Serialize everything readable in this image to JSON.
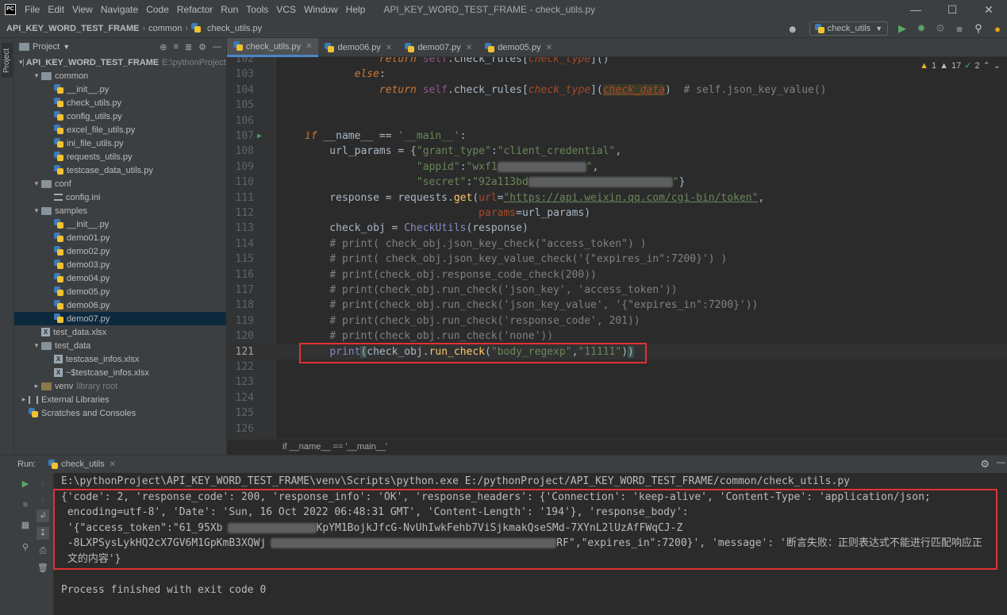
{
  "menubar": {
    "logo_text": "PC",
    "items": [
      "File",
      "Edit",
      "View",
      "Navigate",
      "Code",
      "Refactor",
      "Run",
      "Tools",
      "VCS",
      "Window",
      "Help"
    ],
    "window_title": "API_KEY_WORD_TEST_FRAME - check_utils.py"
  },
  "navbar": {
    "project": "API_KEY_WORD_TEST_FRAME",
    "folder": "common",
    "file": "check_utils.py",
    "run_config": "check_utils"
  },
  "project_panel": {
    "title": "Project",
    "tree": [
      {
        "label": "API_KEY_WORD_TEST_FRAME",
        "extra": "E:\\pythonProject",
        "type": "folder",
        "depth": 0,
        "expanded": true,
        "bold": true
      },
      {
        "label": "common",
        "type": "folder",
        "depth": 1,
        "expanded": true
      },
      {
        "label": "__init__.py",
        "type": "py",
        "depth": 2
      },
      {
        "label": "check_utils.py",
        "type": "py",
        "depth": 2
      },
      {
        "label": "config_utils.py",
        "type": "py",
        "depth": 2
      },
      {
        "label": "excel_file_utils.py",
        "type": "py",
        "depth": 2
      },
      {
        "label": "ini_file_utils.py",
        "type": "py",
        "depth": 2
      },
      {
        "label": "requests_utils.py",
        "type": "py",
        "depth": 2
      },
      {
        "label": "testcase_data_utils.py",
        "type": "py",
        "depth": 2
      },
      {
        "label": "conf",
        "type": "folder",
        "depth": 1,
        "expanded": true
      },
      {
        "label": "config.ini",
        "type": "ini",
        "depth": 2
      },
      {
        "label": "samples",
        "type": "folder",
        "depth": 1,
        "expanded": true
      },
      {
        "label": "__init__.py",
        "type": "py",
        "depth": 2
      },
      {
        "label": "demo01.py",
        "type": "py",
        "depth": 2
      },
      {
        "label": "demo02.py",
        "type": "py",
        "depth": 2
      },
      {
        "label": "demo03.py",
        "type": "py",
        "depth": 2
      },
      {
        "label": "demo04.py",
        "type": "py",
        "depth": 2
      },
      {
        "label": "demo05.py",
        "type": "py",
        "depth": 2
      },
      {
        "label": "demo06.py",
        "type": "py",
        "depth": 2
      },
      {
        "label": "demo07.py",
        "type": "py",
        "depth": 2,
        "selected": true
      },
      {
        "label": "test_data.xlsx",
        "type": "xl",
        "depth": 1
      },
      {
        "label": "test_data",
        "type": "folder",
        "depth": 1,
        "expanded": true
      },
      {
        "label": "testcase_infos.xlsx",
        "type": "xl",
        "depth": 2
      },
      {
        "label": "~$testcase_infos.xlsx",
        "type": "xl",
        "depth": 2
      },
      {
        "label": "venv",
        "extra": "library root",
        "type": "folder",
        "depth": 1,
        "expanded": false,
        "venv": true
      },
      {
        "label": "External Libraries",
        "type": "lib",
        "depth": 0,
        "expanded": false
      },
      {
        "label": "Scratches and Consoles",
        "type": "scratch",
        "depth": 0
      }
    ]
  },
  "editor_tabs": [
    {
      "label": "check_utils.py",
      "active": true
    },
    {
      "label": "demo06.py",
      "active": false
    },
    {
      "label": "demo07.py",
      "active": false
    },
    {
      "label": "demo05.py",
      "active": false
    }
  ],
  "inspections": {
    "warnings": "1",
    "weak_warnings": "17",
    "typos": "2"
  },
  "code_lines": [
    {
      "n": "102",
      "html": "            <span class=\"kw\">return</span> <span class=\"slf\">self</span>.check_rules[<span class=\"par\" style=\"font-style:italic\">check_type</span>]()"
    },
    {
      "n": "103",
      "html": "        <span class=\"kw\">else</span>:"
    },
    {
      "n": "104",
      "html": "            <span class=\"kw\">return</span> <span class=\"slf\">self</span>.check_rules[<span class=\"par\" style=\"font-style:italic\">check_type</span>](<span class=\"par\" style=\"font-style:italic;text-decoration:underline;background:#3b3b2b\">check_data</span>)  <span class=\"cmt\"># self.json_key_value()</span>"
    },
    {
      "n": "105",
      "html": ""
    },
    {
      "n": "106",
      "html": ""
    },
    {
      "n": "107",
      "html": "<span class=\"kw\">if</span> __name__ == <span class=\"str\">'__main__'</span>:",
      "run": true
    },
    {
      "n": "108",
      "html": "    url_params = {<span class=\"str\">\"grant_type\"</span>:<span class=\"str\">\"client_credential\"</span>,"
    },
    {
      "n": "109",
      "html": "                  <span class=\"str\">\"appid\"</span>:<span class=\"str\">\"wxf1</span><span class=\"blurred\" style=\"width:112px\"></span><span class=\"str\">\"</span>,"
    },
    {
      "n": "110",
      "html": "                  <span class=\"str\">\"secret\"</span>:<span class=\"str\">\"92a113bd</span><span class=\"blurred\" style=\"width:182px\"></span><span class=\"str\">\"</span>}"
    },
    {
      "n": "111",
      "html": "    response = requests.<span class=\"fn\">get</span>(<span class=\"par\">url</span>=<span class=\"url\">\"https://api.weixin.qq.com/cgi-bin/token\"</span>,"
    },
    {
      "n": "112",
      "html": "                            <span class=\"par\">params</span>=url_params)"
    },
    {
      "n": "113",
      "html": "    check_obj = <span class=\"blue\">CheckUtils</span>(response)"
    },
    {
      "n": "114",
      "html": "    <span class=\"cmt\"># print( check_obj.json_key_check(\"access_token\") )</span>"
    },
    {
      "n": "115",
      "html": "    <span class=\"cmt\"># print( check_obj.json_key_value_check('{\"expires_in\":7200}') )</span>"
    },
    {
      "n": "116",
      "html": "    <span class=\"cmt\"># print(check_obj.response_code_check(200))</span>"
    },
    {
      "n": "117",
      "html": "    <span class=\"cmt\"># print(check_obj.run_check('json_key', 'access_token'))</span>"
    },
    {
      "n": "118",
      "html": "    <span class=\"cmt\"># print(check_obj.run_check('json_key_value', '{\"expires_in\":7200}'))</span>"
    },
    {
      "n": "119",
      "html": "    <span class=\"cmt\"># print(check_obj.run_check('response_code', 201))</span>"
    },
    {
      "n": "120",
      "html": "    <span class=\"cmt\"># print(check_obj.run_check('none'))</span>"
    },
    {
      "n": "121",
      "html": "    <span class=\"blue\">print</span><span style=\"background:#3b514d\">(</span>check_obj.<span class=\"fn\">run_check</span>(<span class=\"str\">\"body_regexp\"</span>,<span class=\"str\">\"11111\"</span>)<span style=\"background:#3b514d\">)</span>",
      "current": true
    },
    {
      "n": "122",
      "html": ""
    },
    {
      "n": "123",
      "html": ""
    },
    {
      "n": "124",
      "html": ""
    },
    {
      "n": "125",
      "html": ""
    },
    {
      "n": "126",
      "html": ""
    }
  ],
  "editor_breadcrumb": "if __name__ == '__main__'",
  "run_panel": {
    "label": "Run:",
    "tab": "check_utils",
    "command": "E:\\pythonProject\\API_KEY_WORD_TEST_FRAME\\venv\\Scripts\\python.exe E:/pythonProject/API_KEY_WORD_TEST_FRAME/common/check_utils.py",
    "output_lines": [
      "{'code': 2, 'response_code': 200, 'response_info': 'OK', 'response_headers': {'Connection': 'keep-alive', 'Content-Type': 'application/json;",
      " encoding=utf-8', 'Date': 'Sun, 16 Oct 2022 06:48:31 GMT', 'Content-Length': '194'}, 'response_body':",
      " '{\"access_token\":\"61_95Xb",
      " -8LXPSysLykHQ2cX7GV6M1GpKmB3XQWj",
      " 文的内容'}"
    ],
    "output_line3_tail": "KpYM1BojkJfcG-NvUhIwkFehb7ViSjkmakQseSMd-7XYnL2lUzAfFWqCJ-Z",
    "output_line4_tail": "RF\",\"expires_in\":7200}', 'message': '断言失败：正则表达式不能进行匹配响应正",
    "exit_message": "Process finished with exit code 0"
  }
}
